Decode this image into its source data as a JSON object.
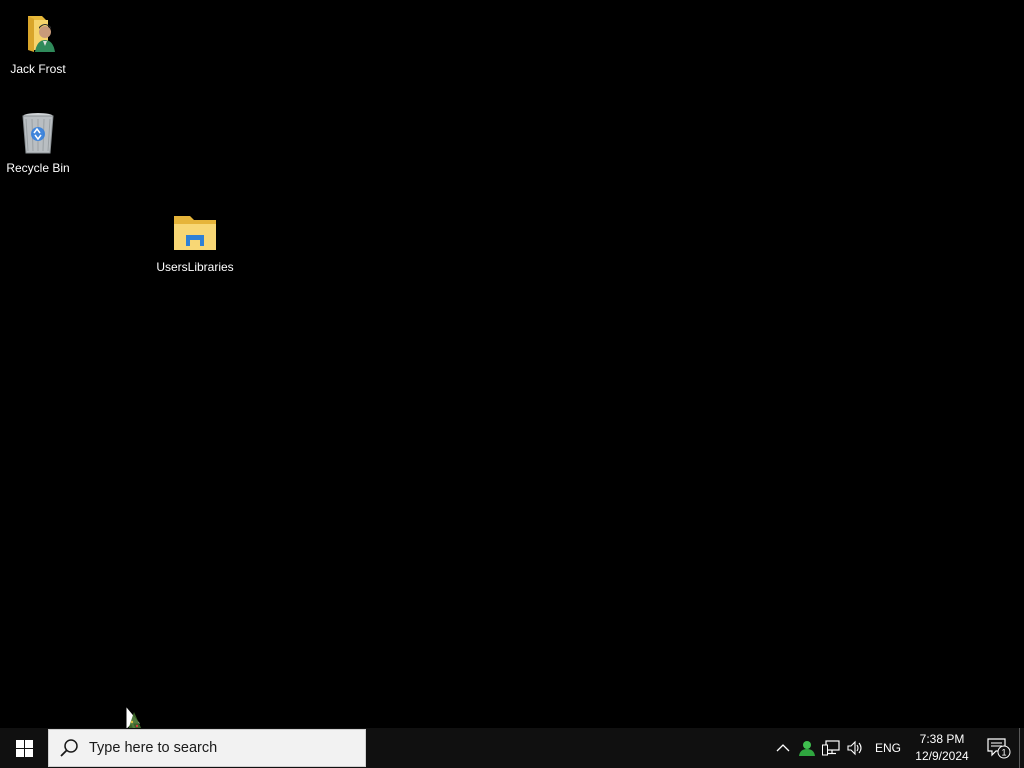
{
  "desktop": {
    "background_color": "#000000",
    "icons": [
      {
        "label": "Jack Frost",
        "icon": "user-folder-icon"
      },
      {
        "label": "Recycle Bin",
        "icon": "recycle-bin-icon"
      },
      {
        "label": "UsersLibraries",
        "icon": "file-explorer-folder-icon"
      }
    ]
  },
  "taskbar": {
    "background_color": "#101010",
    "start_icon": "windows-logo-icon",
    "search": {
      "placeholder": "Type here to search",
      "icon": "search-icon"
    },
    "tray": {
      "overflow_icon": "chevron-up-icon",
      "people_icon": "people-icon",
      "network_icon": "network-icon",
      "volume_icon": "speaker-icon",
      "language": "ENG",
      "time": "7:38 PM",
      "date": "12/9/2024",
      "notification_count": "1"
    }
  }
}
